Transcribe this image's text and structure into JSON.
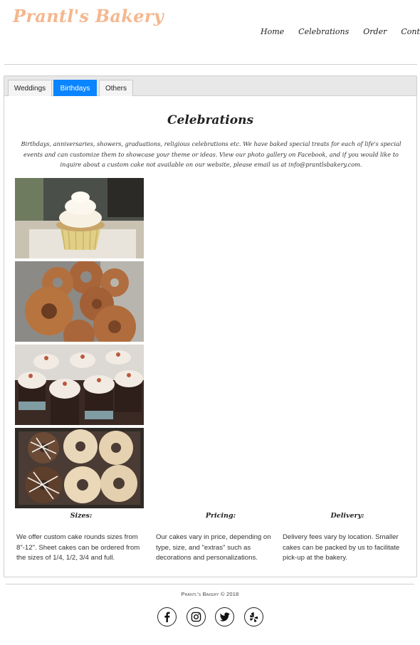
{
  "header": {
    "logo": "Prantl's Bakery",
    "nav": [
      "Home",
      "Celebrations",
      "Order",
      "Contact"
    ]
  },
  "tabs": [
    {
      "label": "Weddings",
      "active": false
    },
    {
      "label": "Birthdays",
      "active": true
    },
    {
      "label": "Others",
      "active": false
    }
  ],
  "content": {
    "title": "Celebrations",
    "intro": "Birthdays, anniversaries, showers, graduations, religious celebrations etc. We have baked special treats for each of life's special events and can customize them to showcase your theme or ideas. View our photo gallery on Facebook, and if you would like to inquire about a custom cake not available on our website, please email us at info@prantlsbakery.com.",
    "photos": [
      "cupcake-photo",
      "glazed-donuts-photo",
      "chocolate-cupcakes-photo",
      "drizzled-donuts-photo"
    ],
    "columns": [
      {
        "heading": "Sizes:",
        "text": "We offer custom cake rounds sizes from 8\"-12\". Sheet cakes can be ordered from the sizes of 1/4, 1/2, 3/4 and full."
      },
      {
        "heading": "Pricing:",
        "text": "Our cakes vary in price, depending on type, size, and \"extras\" such as decorations and personalizations."
      },
      {
        "heading": "Delivery:",
        "text": "Delivery fees vary by location. Smaller cakes can be packed by us to facilitate pick-up at the bakery."
      }
    ]
  },
  "footer": {
    "copyright": "Prantl's Bakery © 2018",
    "social": [
      "facebook-icon",
      "instagram-icon",
      "twitter-icon",
      "yelp-icon"
    ]
  },
  "colors": {
    "accent": "#0a84ff",
    "logo": "#f5b78f"
  }
}
